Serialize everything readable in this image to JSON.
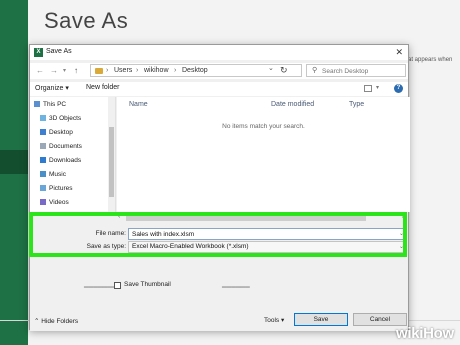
{
  "backstage": {
    "title": "Save As",
    "side_text": "at appears when"
  },
  "dialog": {
    "title": "Save As",
    "close_glyph": "✕",
    "address": {
      "path": [
        "Users",
        "wikihow",
        "Desktop"
      ],
      "search_placeholder": "Search Desktop"
    },
    "toolbar": {
      "organize": "Organize ▾",
      "new_folder": "New folder",
      "help": "?"
    },
    "nav_items": [
      {
        "label": "This PC",
        "icon": "pc-icon"
      },
      {
        "label": "3D Objects",
        "icon": "cube-icon"
      },
      {
        "label": "Desktop",
        "icon": "desktop-icon"
      },
      {
        "label": "Documents",
        "icon": "documents-icon"
      },
      {
        "label": "Downloads",
        "icon": "downloads-icon"
      },
      {
        "label": "Music",
        "icon": "music-icon"
      },
      {
        "label": "Pictures",
        "icon": "pictures-icon"
      },
      {
        "label": "Videos",
        "icon": "videos-icon"
      }
    ],
    "columns": [
      "Name",
      "Date modified",
      "Type"
    ],
    "empty_message": "No items match your search.",
    "file_name_label": "File name:",
    "file_name_value": "Sales with index.xlsm",
    "save_type_label": "Save as type:",
    "save_type_value": "Excel Macro-Enabled Workbook (*.xlsm)",
    "save_thumbnail_label": "Save Thumbnail",
    "hide_folders": "Hide Folders",
    "tools": "Tools",
    "save_button": "Save",
    "cancel_button": "Cancel"
  },
  "watermark": "wikiHow",
  "colors": {
    "excel_green": "#1e7145",
    "highlight_green": "#2be51a",
    "save_border": "#0078d7"
  }
}
